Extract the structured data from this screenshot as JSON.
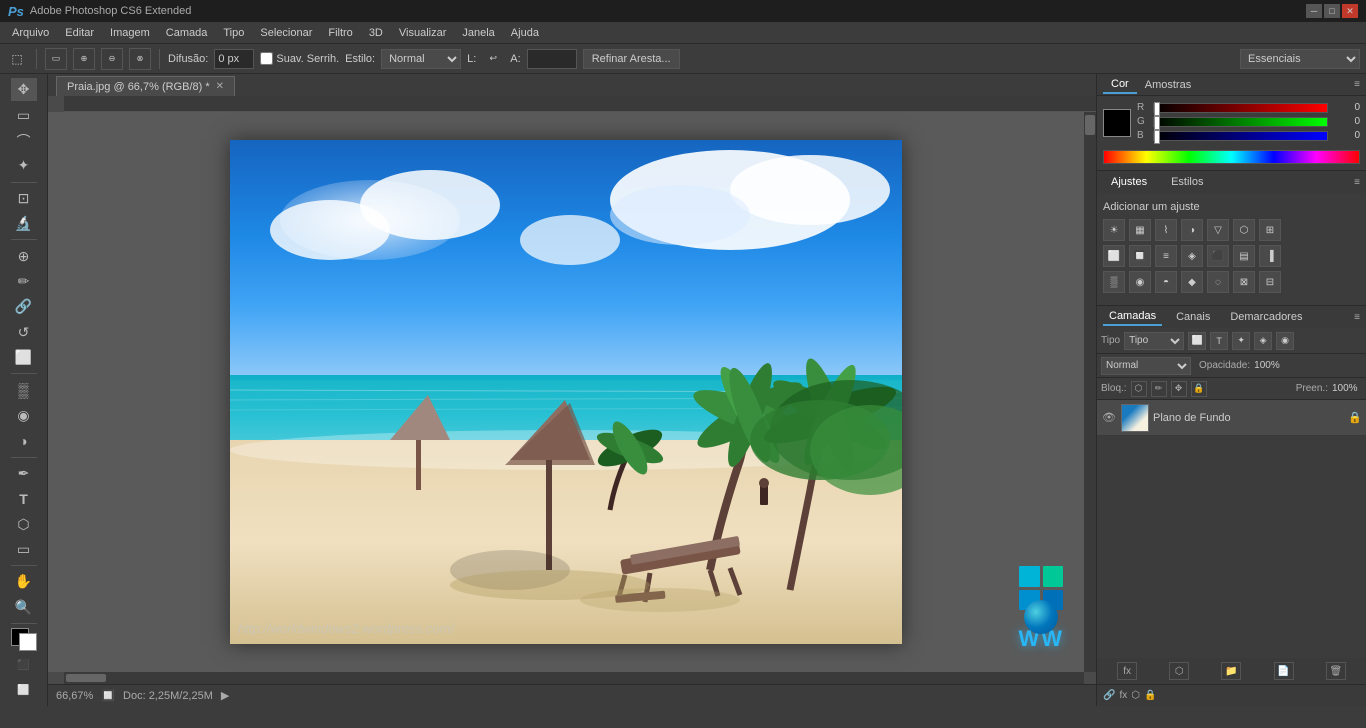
{
  "titlebar": {
    "app": "Ps",
    "title": "Adobe Photoshop CS6 Extended",
    "controls": [
      "─",
      "□",
      "✕"
    ]
  },
  "menubar": {
    "items": [
      "Arquivo",
      "Editar",
      "Imagem",
      "Camada",
      "Tipo",
      "Selecionar",
      "Filtro",
      "3D",
      "Visualizar",
      "Janela",
      "Ajuda"
    ]
  },
  "optionsbar": {
    "diffusion_label": "Difusão:",
    "diffusion_value": "0 px",
    "smooth_label": "Suav. Serrih.",
    "style_label": "Estilo:",
    "style_value": "Normal",
    "refine_btn": "Refinar Aresta...",
    "workspace_value": "Essenciais"
  },
  "document": {
    "tab_title": "Praia.jpg @ 66,7% (RGB/8) *",
    "zoom": "66,67%",
    "doc_size": "Doc: 2,25M/2,25M"
  },
  "color_panel": {
    "tab_cor": "Cor",
    "tab_amostras": "Amostras",
    "r_label": "R",
    "r_value": "0",
    "g_label": "G",
    "g_value": "0",
    "b_label": "B",
    "b_value": "0"
  },
  "adjustments_panel": {
    "tab_ajustes": "Ajustes",
    "tab_estilos": "Estilos",
    "add_title": "Adicionar um ajuste"
  },
  "layers_panel": {
    "tab_camadas": "Camadas",
    "tab_canais": "Canais",
    "tab_demarcadores": "Demarcadores",
    "filter_label": "Tipo",
    "blend_mode": "Normal",
    "opacity_label": "Opacidade:",
    "opacity_value": "100%",
    "lock_label": "Bloq.:",
    "fill_label": "Preen.:",
    "fill_value": "100%",
    "layer_name": "Plano de Fundo"
  },
  "watermark": {
    "text": "http://worldwindows2.wordpress.com/"
  },
  "status": {
    "zoom": "66,67%"
  }
}
